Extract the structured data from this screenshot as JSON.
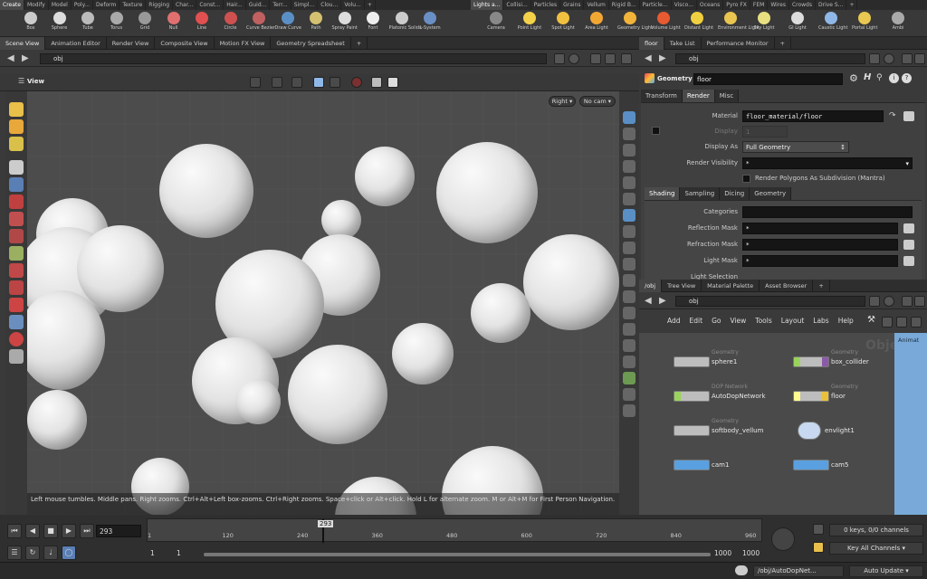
{
  "shelf": {
    "left_tabs": [
      "Create",
      "Modify",
      "Model",
      "Poly...",
      "Deform",
      "Texture",
      "Rigging",
      "Char...",
      "Const...",
      "Hair...",
      "Guid...",
      "Terr...",
      "Simpl...",
      "Clou...",
      "Volu...",
      "+"
    ],
    "right_tabs": [
      "Lights a...",
      "Collisi...",
      "Particles",
      "Grains",
      "Vellum",
      "Rigid B...",
      "Particle...",
      "Visco...",
      "Oceans",
      "Pyro FX",
      "FEM",
      "Wires",
      "Crowds",
      "Drive S...",
      "+"
    ],
    "left_tools": [
      "Box",
      "Sphere",
      "Tube",
      "Torus",
      "Grid",
      "Null",
      "Line",
      "Circle",
      "Curve Bezier",
      "Draw Curve",
      "Path",
      "Spray Paint",
      "Font",
      "Platonic Solids",
      "L-System"
    ],
    "right_tools": [
      "Camera",
      "Point Light",
      "Spot Light",
      "Area Light",
      "Geometry Light",
      "Volume Light",
      "Distant Light",
      "Environment Light",
      "Sky Light",
      "GI Light",
      "Caustic Light",
      "Portal Light",
      "Ambi"
    ]
  },
  "left_pane": {
    "tabs": [
      "Scene View",
      "Animation Editor",
      "Render View",
      "Composite View",
      "Motion FX View",
      "Geometry Spreadsheet",
      "+"
    ],
    "path": "obj",
    "view_label": "View",
    "camera_menu": "No cam",
    "view_menu": "Right",
    "hint": "Left mouse tumbles. Middle pans. Right zooms. Ctrl+Alt+Left box-zooms. Ctrl+Right zooms. Space+click or Alt+click. Hold L for alternate zoom. M or Alt+M for First Person Navigation."
  },
  "param_pane": {
    "tabs": [
      "floor",
      "Take List",
      "Performance Monitor",
      "+"
    ],
    "path": "obj",
    "node_type": "Geometry",
    "node_name": "floor",
    "main_tabs": [
      "Transform",
      "Render",
      "Misc"
    ],
    "material_label": "Material",
    "material_value": "floor_material/floor",
    "display_label": "Display",
    "display_value": "1",
    "display_as_label": "Display As",
    "display_as_value": "Full Geometry",
    "render_visibility_label": "Render Visibility",
    "render_visibility_value": "*",
    "render_polygons_label": "Render Polygons As Subdivision (Mantra)",
    "sub_tabs": [
      "Shading",
      "Sampling",
      "Dicing",
      "Geometry"
    ],
    "categories_label": "Categories",
    "reflection_mask_label": "Reflection Mask",
    "reflection_mask_value": "*",
    "refraction_mask_label": "Refraction Mask",
    "refraction_mask_value": "*",
    "light_mask_label": "Light Mask",
    "light_mask_value": "*",
    "light_selection_label": "Light Selection"
  },
  "network_pane": {
    "tabs": [
      "/obj",
      "Tree View",
      "Material Palette",
      "Asset Browser",
      "+"
    ],
    "path": "obj",
    "menu": [
      "Add",
      "Edit",
      "Go",
      "View",
      "Tools",
      "Layout",
      "Labs",
      "Help"
    ],
    "watermark": "Objects",
    "side_label": "Animat",
    "nodes": [
      {
        "type": "Geometry",
        "name": "sphere1"
      },
      {
        "type": "Geometry",
        "name": "box_collider"
      },
      {
        "type": "DOP Network",
        "name": "AutoDopNetwork"
      },
      {
        "type": "Geometry",
        "name": "floor"
      },
      {
        "type": "Geometry",
        "name": "softbody_vellum"
      },
      {
        "type": "",
        "name": "envlight1"
      },
      {
        "type": "",
        "name": "cam1"
      },
      {
        "type": "",
        "name": "cam5"
      }
    ]
  },
  "timeline": {
    "current_frame": "293",
    "frame_marker": "293",
    "ticks": [
      "1",
      "120",
      "240",
      "360",
      "480",
      "600",
      "720",
      "840",
      "960"
    ],
    "range_start": "1",
    "range_start2": "1",
    "range_end": "1000",
    "range_end2": "1000",
    "keys_info": "0 keys, 0/0 channels",
    "key_all": "Key All Channels",
    "status_path": "/obj/AutoDopNet...",
    "update_mode": "Auto Update"
  },
  "colors": {
    "accent": "#f3a733",
    "node_green": "#9ad35c",
    "node_blue": "#5aa0e0",
    "selected_node": "#fffb8f"
  }
}
